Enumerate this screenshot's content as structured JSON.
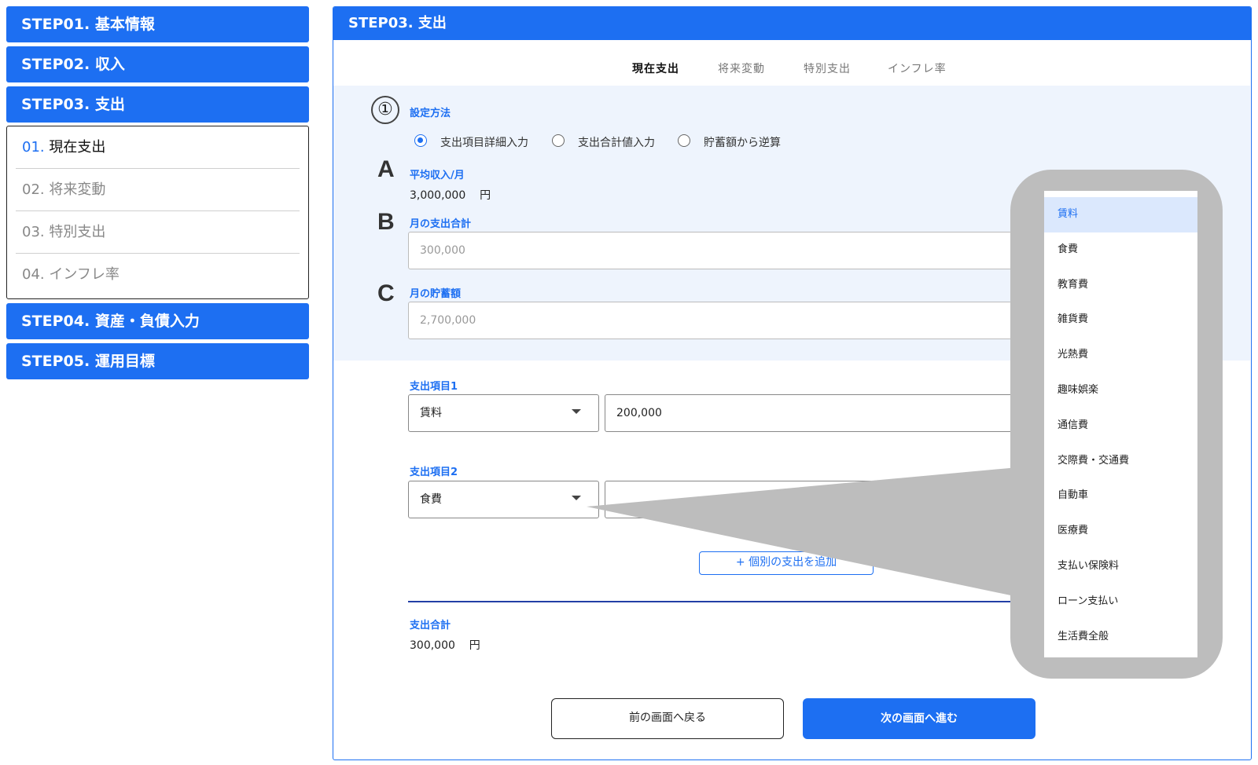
{
  "sidebar": {
    "steps": [
      {
        "label": "STEP01. 基本情報"
      },
      {
        "label": "STEP02. 収入"
      },
      {
        "label": "STEP03. 支出"
      },
      {
        "label": "STEP04. 資産・負債入力"
      },
      {
        "label": "STEP05. 運用目標"
      }
    ],
    "substeps": [
      {
        "num": "01.",
        "label": "現在支出"
      },
      {
        "num": "02.",
        "label": "将来変動"
      },
      {
        "num": "03.",
        "label": "特別支出"
      },
      {
        "num": "04.",
        "label": "インフレ率"
      }
    ]
  },
  "panel": {
    "title": "STEP03. 支出",
    "tabs": [
      "現在支出",
      "将来変動",
      "特別支出",
      "インフレ率"
    ],
    "active_tab": "現在支出"
  },
  "setting": {
    "marker": "①",
    "label": "設定方法",
    "options": [
      "支出項目詳細入力",
      "支出合計値入力",
      "貯蓄額から逆算"
    ],
    "selected": "支出項目詳細入力"
  },
  "section_a": {
    "letter": "A",
    "label": "平均収入/月",
    "value": "3,000,000",
    "unit": "円"
  },
  "section_b": {
    "letter": "B",
    "label": "月の支出合計",
    "value": "300,000"
  },
  "section_c": {
    "letter": "C",
    "label": "月の貯蓄額",
    "value": "2,700,000"
  },
  "expense_items": [
    {
      "label": "支出項目1",
      "category": "賃料",
      "amount": "200,000"
    },
    {
      "label": "支出項目2",
      "category": "食費",
      "amount": ""
    }
  ],
  "add_button": "+ 個別の支出を追加",
  "total": {
    "label": "支出合計",
    "value": "300,000",
    "unit": "円"
  },
  "buttons": {
    "prev": "前の画面へ戻る",
    "next": "次の画面へ進む"
  },
  "dropdown": {
    "options": [
      "賃料",
      "食費",
      "教育費",
      "雑貨費",
      "光熱費",
      "趣味娯楽",
      "通信費",
      "交際費・交通費",
      "自動車",
      "医療費",
      "支払い保険料",
      "ローン支払い",
      "生活費全般"
    ],
    "selected": "賃料"
  },
  "colors": {
    "primary": "#1d6ff2",
    "panel_bg": "#eef4fd",
    "callout_gray": "#bdbdbd"
  }
}
